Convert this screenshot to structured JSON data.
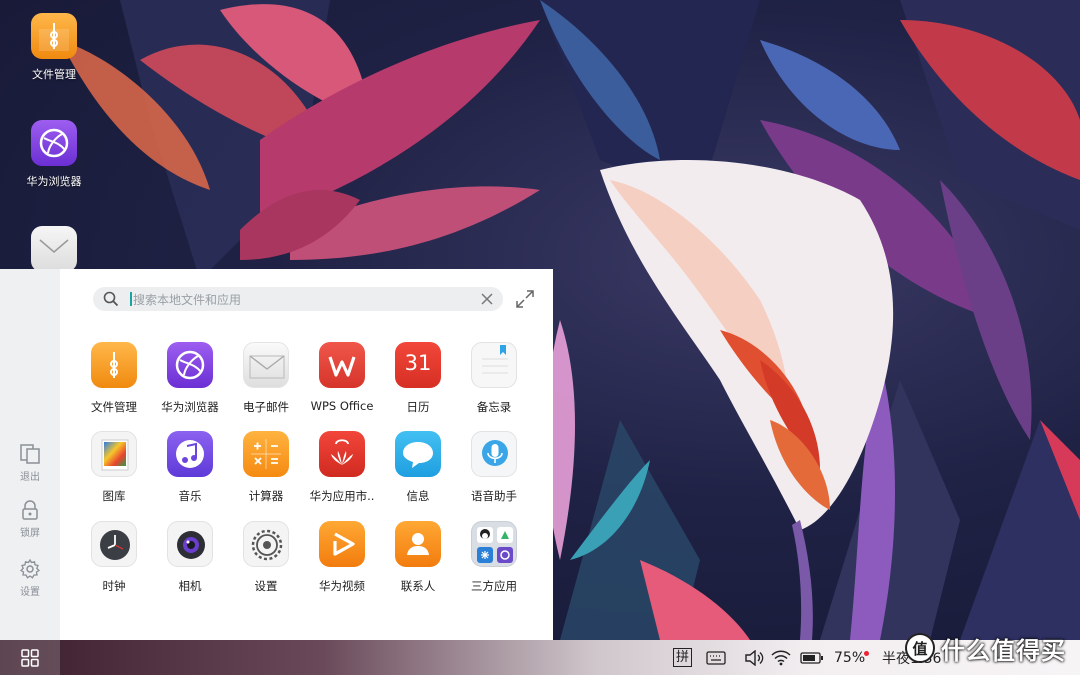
{
  "desktop": {
    "icons": [
      {
        "label": "文件管理",
        "icon": "file-manager-icon"
      },
      {
        "label": "华为浏览器",
        "icon": "browser-icon"
      },
      {
        "label": "",
        "icon": "mail-icon"
      }
    ]
  },
  "start_panel": {
    "search": {
      "placeholder": "搜索本地文件和应用"
    },
    "side": [
      {
        "label": "退出",
        "icon": "exit-icon"
      },
      {
        "label": "锁屏",
        "icon": "lock-icon"
      },
      {
        "label": "设置",
        "icon": "gear-icon"
      }
    ],
    "apps": [
      {
        "label": "文件管理",
        "icon": "file-manager-icon"
      },
      {
        "label": "华为浏览器",
        "icon": "browser-icon"
      },
      {
        "label": "电子邮件",
        "icon": "mail-icon"
      },
      {
        "label": "WPS Office",
        "icon": "wps-icon"
      },
      {
        "label": "日历",
        "icon": "calendar-icon",
        "badge": "31"
      },
      {
        "label": "备忘录",
        "icon": "notes-icon"
      },
      {
        "label": "图库",
        "icon": "gallery-icon"
      },
      {
        "label": "音乐",
        "icon": "music-icon"
      },
      {
        "label": "计算器",
        "icon": "calculator-icon"
      },
      {
        "label": "华为应用市..",
        "icon": "appgallery-icon"
      },
      {
        "label": "信息",
        "icon": "messages-icon"
      },
      {
        "label": "语音助手",
        "icon": "voice-assistant-icon"
      },
      {
        "label": "时钟",
        "icon": "clock-icon"
      },
      {
        "label": "相机",
        "icon": "camera-icon"
      },
      {
        "label": "设置",
        "icon": "settings-icon"
      },
      {
        "label": "华为视频",
        "icon": "video-icon"
      },
      {
        "label": "联系人",
        "icon": "contacts-icon"
      },
      {
        "label": "三方应用",
        "icon": "third-party-folder-icon"
      }
    ]
  },
  "taskbar": {
    "ime_label": "拼",
    "battery": "75%",
    "time": "半夜1:36",
    "watermark": "什么值得买",
    "watermark_badge": "值"
  },
  "colors": {
    "accent": "#1aa3a3",
    "panel_bg": "#ffffff",
    "side_bg": "#eef0f2"
  }
}
